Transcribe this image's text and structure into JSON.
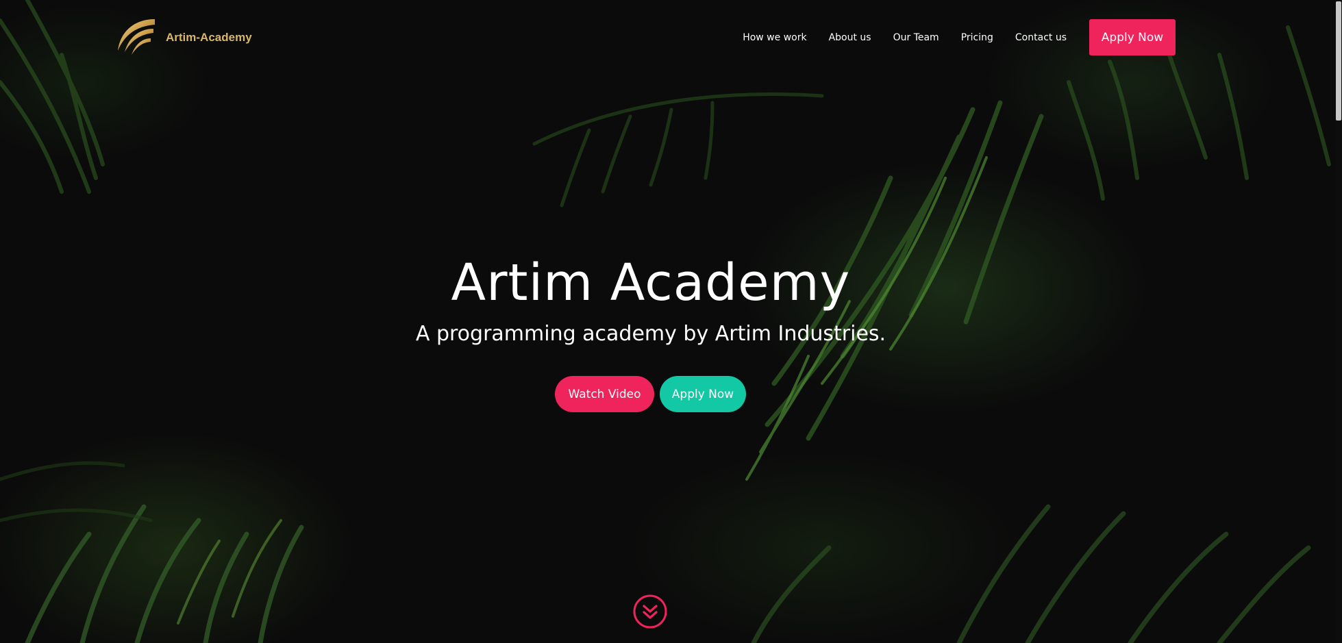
{
  "brand": {
    "name": "Artim-Academy",
    "logo_icon": "golden-swoosh-logo-icon",
    "color": "#d9b76a"
  },
  "nav": {
    "items": [
      {
        "label": "How we work"
      },
      {
        "label": "About us"
      },
      {
        "label": "Our Team"
      },
      {
        "label": "Pricing"
      },
      {
        "label": "Contact us"
      }
    ],
    "cta_label": "Apply Now"
  },
  "hero": {
    "title": "Artim Academy",
    "subtitle": "A programming academy by Artim Industries.",
    "watch_video_label": "Watch Video",
    "apply_now_label": "Apply Now",
    "scroll_icon": "double-chevron-down-icon"
  },
  "colors": {
    "accent_pink": "#f0245c",
    "accent_teal": "#13c9a5",
    "background": "#0b0b0b"
  }
}
